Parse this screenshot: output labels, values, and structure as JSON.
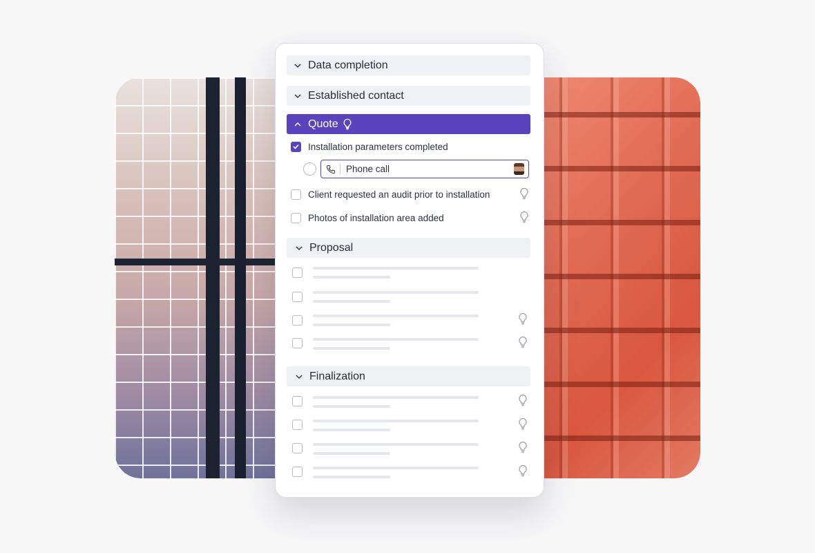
{
  "sections": {
    "data_completion": "Data completion",
    "established_contact": "Established contact",
    "quote": "Quote",
    "proposal": "Proposal",
    "finalization": "Finalization"
  },
  "quote_items": [
    {
      "label": "Installation parameters completed",
      "checked": true
    },
    {
      "label": "Client requested an audit prior to installation",
      "checked": false
    },
    {
      "label": "Photos of installation area added",
      "checked": false
    }
  ],
  "phone_call": {
    "label": "Phone call"
  },
  "colors": {
    "accent": "#5a44bd",
    "section_bg": "#f0f1f5",
    "placeholder": "#e6e7ec"
  }
}
